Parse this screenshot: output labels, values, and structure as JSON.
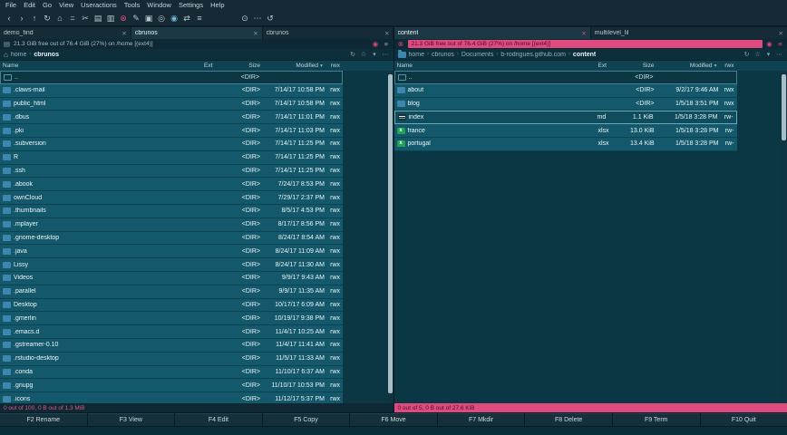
{
  "app": {
    "accent_pink": "#df4a7f",
    "row_teal": "#14596b"
  },
  "menu": {
    "items": [
      "File",
      "Edit",
      "Go",
      "View",
      "Useractions",
      "Tools",
      "Window",
      "Settings",
      "Help"
    ]
  },
  "toolbar": {
    "icons": [
      {
        "name": "back-icon",
        "glyph": "‹"
      },
      {
        "name": "forward-icon",
        "glyph": "›"
      },
      {
        "name": "up-icon",
        "glyph": "↑"
      },
      {
        "name": "refresh-icon",
        "glyph": "↻"
      },
      {
        "name": "home-icon",
        "glyph": "⌂"
      },
      {
        "name": "equal-panels-icon",
        "glyph": "="
      },
      {
        "name": "cut-icon",
        "glyph": "✂"
      },
      {
        "name": "copy-icon",
        "glyph": "▤"
      },
      {
        "name": "paste-icon",
        "glyph": "▥"
      },
      {
        "name": "delete-icon",
        "glyph": "⊗",
        "color": "pink"
      },
      {
        "name": "edit-icon",
        "glyph": "✎"
      },
      {
        "name": "new-folder-icon",
        "glyph": "▣"
      },
      {
        "name": "find-icon",
        "glyph": "◎"
      },
      {
        "name": "useraction-icon",
        "glyph": "◉",
        "color": "blue"
      },
      {
        "name": "sync-dirs-icon",
        "glyph": "⇄"
      },
      {
        "name": "popular-urls-icon",
        "glyph": "≡"
      }
    ],
    "right_icons": [
      {
        "name": "settings-icon",
        "glyph": "⊙"
      },
      {
        "name": "more-icon",
        "glyph": "⋯"
      },
      {
        "name": "undo-icon",
        "glyph": "↺"
      }
    ]
  },
  "columns": {
    "name": "Name",
    "ext": "Ext",
    "size": "Size",
    "modified": "Modified",
    "perm": "rwx",
    "sort_indicator": "▾"
  },
  "left_panel": {
    "tabs": [
      {
        "label": "demo_find",
        "active": false
      },
      {
        "label": "cbrunos",
        "active": true
      },
      {
        "label": "cbrunos",
        "active": false
      }
    ],
    "lead_icon": "▤",
    "disk_info": "21.3 GiB free out of 76.4 GiB (27%) on /home [(ext4)]",
    "bar_icons": [
      {
        "name": "media-icon",
        "glyph": "◉"
      },
      {
        "name": "panel-menu-icon",
        "glyph": "≡"
      }
    ],
    "crumb_lead": "⌂",
    "breadcrumb": [
      "home",
      "cbrunos"
    ],
    "crumb_icons": [
      {
        "name": "refresh-icon",
        "glyph": "↻"
      },
      {
        "name": "bookmarks-icon",
        "glyph": "☆"
      },
      {
        "name": "history-icon",
        "glyph": "▾"
      },
      {
        "name": "options-icon",
        "glyph": "⋯"
      }
    ],
    "rows": [
      {
        "name": "..",
        "ext": "",
        "size": "<DIR>",
        "modified": "",
        "perm": "",
        "icon": "updir",
        "state": "updir"
      },
      {
        "name": ".claws-mail",
        "ext": "",
        "size": "<DIR>",
        "modified": "7/14/17 10:58 PM",
        "perm": "rwx",
        "icon": "folder"
      },
      {
        "name": "public_html",
        "ext": "",
        "size": "<DIR>",
        "modified": "7/14/17 10:58 PM",
        "perm": "rwx",
        "icon": "folder"
      },
      {
        "name": ".dbus",
        "ext": "",
        "size": "<DIR>",
        "modified": "7/14/17 11:01 PM",
        "perm": "rwx",
        "icon": "folder"
      },
      {
        "name": ".pki",
        "ext": "",
        "size": "<DIR>",
        "modified": "7/14/17 11:03 PM",
        "perm": "rwx",
        "icon": "folder"
      },
      {
        "name": ".subversion",
        "ext": "",
        "size": "<DIR>",
        "modified": "7/14/17 11:25 PM",
        "perm": "rwx",
        "icon": "folder"
      },
      {
        "name": "R",
        "ext": "",
        "size": "<DIR>",
        "modified": "7/14/17 11:25 PM",
        "perm": "rwx",
        "icon": "folder"
      },
      {
        "name": ".ssh",
        "ext": "",
        "size": "<DIR>",
        "modified": "7/14/17 11:25 PM",
        "perm": "rwx",
        "icon": "folder"
      },
      {
        "name": ".abook",
        "ext": "",
        "size": "<DIR>",
        "modified": "7/24/17 8:53 PM",
        "perm": "rwx",
        "icon": "folder"
      },
      {
        "name": "ownCloud",
        "ext": "",
        "size": "<DIR>",
        "modified": "7/29/17 2:37 PM",
        "perm": "rwx",
        "icon": "folder"
      },
      {
        "name": ".thumbnails",
        "ext": "",
        "size": "<DIR>",
        "modified": "8/5/17 4:53 PM",
        "perm": "rwx",
        "icon": "folder"
      },
      {
        "name": ".mplayer",
        "ext": "",
        "size": "<DIR>",
        "modified": "8/17/17 8:56 PM",
        "perm": "rwx",
        "icon": "folder"
      },
      {
        "name": ".gnome-desktop",
        "ext": "",
        "size": "<DIR>",
        "modified": "8/24/17 8:54 AM",
        "perm": "rwx",
        "icon": "folder"
      },
      {
        "name": ".java",
        "ext": "",
        "size": "<DIR>",
        "modified": "8/24/17 11:09 AM",
        "perm": "rwx",
        "icon": "folder"
      },
      {
        "name": "Lissy",
        "ext": "",
        "size": "<DIR>",
        "modified": "8/24/17 11:30 AM",
        "perm": "rwx",
        "icon": "folder"
      },
      {
        "name": "Videos",
        "ext": "",
        "size": "<DIR>",
        "modified": "9/9/17 9:43 AM",
        "perm": "rwx",
        "icon": "folder"
      },
      {
        "name": ".parallel",
        "ext": "",
        "size": "<DIR>",
        "modified": "9/9/17 11:35 AM",
        "perm": "rwx",
        "icon": "folder"
      },
      {
        "name": "Desktop",
        "ext": "",
        "size": "<DIR>",
        "modified": "10/17/17 6:09 AM",
        "perm": "rwx",
        "icon": "folder"
      },
      {
        "name": ".gmerlin",
        "ext": "",
        "size": "<DIR>",
        "modified": "10/19/17 9:38 PM",
        "perm": "rwx",
        "icon": "folder"
      },
      {
        "name": ".emacs.d",
        "ext": "",
        "size": "<DIR>",
        "modified": "11/4/17 10:25 AM",
        "perm": "rwx",
        "icon": "folder"
      },
      {
        "name": ".gstreamer-0.10",
        "ext": "",
        "size": "<DIR>",
        "modified": "11/4/17 11:41 AM",
        "perm": "rwx",
        "icon": "folder"
      },
      {
        "name": ".rstudio-desktop",
        "ext": "",
        "size": "<DIR>",
        "modified": "11/5/17 11:33 AM",
        "perm": "rwx",
        "icon": "folder"
      },
      {
        "name": ".conda",
        "ext": "",
        "size": "<DIR>",
        "modified": "11/10/17 6:37 AM",
        "perm": "rwx",
        "icon": "folder"
      },
      {
        "name": ".gnupg",
        "ext": "",
        "size": "<DIR>",
        "modified": "11/10/17 10:53 PM",
        "perm": "rwx",
        "icon": "folder"
      },
      {
        "name": ".icons",
        "ext": "",
        "size": "<DIR>",
        "modified": "11/12/17 5:37 PM",
        "perm": "rwx",
        "icon": "folder"
      }
    ],
    "status": "0 out of 100, 0 B out of 1.3 MiB"
  },
  "right_panel": {
    "tabs": [
      {
        "label": "content",
        "active": true,
        "close_pink": true
      },
      {
        "label": "multilevel_lil",
        "active": false
      }
    ],
    "lead_icon": "⊗",
    "disk_info": "21.3 GiB free out of 76.4 GiB (27%) on /home [(ext4)]",
    "bar_icons": [
      {
        "name": "media-icon",
        "glyph": "◉"
      },
      {
        "name": "panel-menu-icon",
        "glyph": "≡"
      }
    ],
    "breadcrumb": [
      "home",
      "cbrunos",
      "Documents",
      "b-rodrigues.github.com",
      "content"
    ],
    "crumb_icons": [
      {
        "name": "refresh-icon",
        "glyph": "↻"
      },
      {
        "name": "bookmarks-icon",
        "glyph": "☆"
      },
      {
        "name": "history-icon",
        "glyph": "▾"
      },
      {
        "name": "options-icon",
        "glyph": "⋯"
      }
    ],
    "rows": [
      {
        "name": "..",
        "ext": "",
        "size": "<DIR>",
        "modified": "",
        "perm": "",
        "icon": "updir",
        "state": "updir"
      },
      {
        "name": "about",
        "ext": "",
        "size": "<DIR>",
        "modified": "9/2/17 9:46 AM",
        "perm": "rwx",
        "icon": "folder"
      },
      {
        "name": "blog",
        "ext": "",
        "size": "<DIR>",
        "modified": "1/5/18 3:51 PM",
        "perm": "rwx",
        "icon": "folder"
      },
      {
        "name": "index",
        "ext": "md",
        "size": "1.1 KiB",
        "modified": "1/5/18 3:28 PM",
        "perm": "rw-",
        "icon": "md",
        "state": "cursor"
      },
      {
        "name": "france",
        "ext": "xlsx",
        "size": "13.0 KiB",
        "modified": "1/5/18 3:28 PM",
        "perm": "rw-",
        "icon": "xlsx"
      },
      {
        "name": "portugal",
        "ext": "xlsx",
        "size": "13.4 KiB",
        "modified": "1/5/18 3:28 PM",
        "perm": "rw-",
        "icon": "xlsx"
      }
    ],
    "status": "0 out of 5, 0 B out of 27.6 KiB"
  },
  "fkeys": [
    {
      "label": "F2 Rename"
    },
    {
      "label": "F3 View"
    },
    {
      "label": "F4 Edit"
    },
    {
      "label": "F5 Copy"
    },
    {
      "label": "F6 Move"
    },
    {
      "label": "F7 Mkdir"
    },
    {
      "label": "F8 Delete"
    },
    {
      "label": "F9 Term"
    },
    {
      "label": "F10 Quit"
    }
  ]
}
